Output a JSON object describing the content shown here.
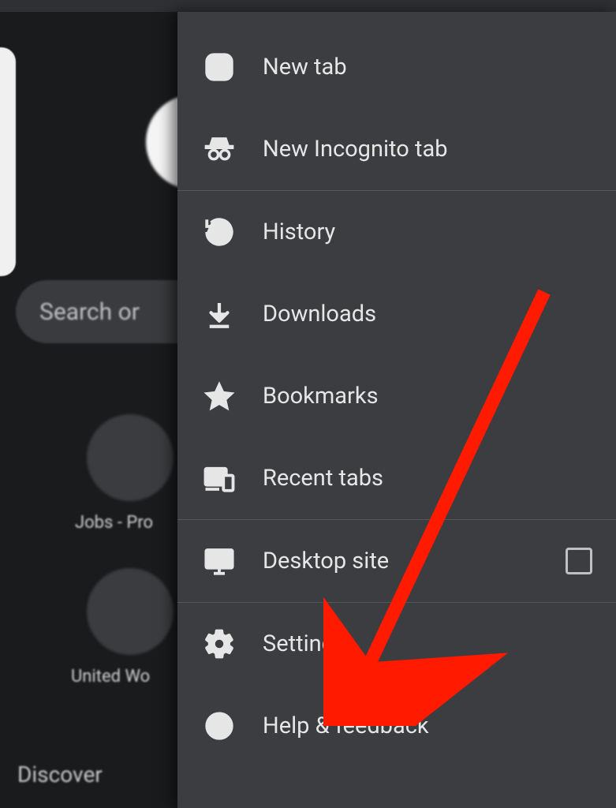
{
  "background": {
    "search_placeholder": "Search or",
    "shortcuts": [
      {
        "label": "Jobs - Pro"
      },
      {
        "label": "United Wo"
      }
    ],
    "discover_label": "Discover"
  },
  "menu": {
    "items": [
      {
        "label": "New tab"
      },
      {
        "label": "New Incognito tab"
      },
      {
        "label": "History"
      },
      {
        "label": "Downloads"
      },
      {
        "label": "Bookmarks"
      },
      {
        "label": "Recent tabs"
      },
      {
        "label": "Desktop site"
      },
      {
        "label": "Settings"
      },
      {
        "label": "Help & feedback"
      }
    ]
  }
}
